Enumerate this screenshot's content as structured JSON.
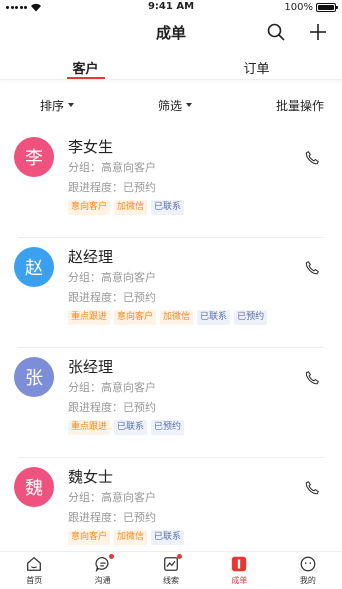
{
  "status": {
    "time": "9:41 AM",
    "battery": "100%",
    "battery_level": 1.0
  },
  "header": {
    "title": "成单"
  },
  "tabs": [
    {
      "label": "客户",
      "active": true
    },
    {
      "label": "订单",
      "active": false
    }
  ],
  "filters": {
    "sort": "排序",
    "filter": "筛选",
    "batch": "批量操作"
  },
  "customers": [
    {
      "avatar": "李",
      "name": "李女生",
      "group": "分组：高意向客户",
      "progress": "跟进程度：已预约",
      "color": "#f0527f",
      "tags": [
        {
          "text": "意向客户",
          "tone": "orange"
        },
        {
          "text": "加微信",
          "tone": "orange"
        },
        {
          "text": "已联系",
          "tone": "blue"
        }
      ]
    },
    {
      "avatar": "赵",
      "name": "赵经理",
      "group": "分组：高意向客户",
      "progress": "跟进程度：已预约",
      "color": "#3aa0f0",
      "tags": [
        {
          "text": "重点跟进",
          "tone": "orange"
        },
        {
          "text": "意向客户",
          "tone": "orange"
        },
        {
          "text": "加微信",
          "tone": "orange"
        },
        {
          "text": "已联系",
          "tone": "blue"
        },
        {
          "text": "已预约",
          "tone": "blue"
        }
      ]
    },
    {
      "avatar": "张",
      "name": "张经理",
      "group": "分组：高意向客户",
      "progress": "跟进程度：已预约",
      "color": "#7d8ed8",
      "tags": [
        {
          "text": "重点跟进",
          "tone": "orange"
        },
        {
          "text": "已联系",
          "tone": "blue"
        },
        {
          "text": "已预约",
          "tone": "blue"
        }
      ]
    },
    {
      "avatar": "魏",
      "name": "魏女士",
      "group": "分组：高意向客户",
      "progress": "跟进程度：已预约",
      "color": "#f0527f",
      "tags": [
        {
          "text": "意向客户",
          "tone": "orange"
        },
        {
          "text": "加微信",
          "tone": "orange"
        },
        {
          "text": "已联系",
          "tone": "blue"
        }
      ]
    }
  ],
  "bottom_nav": [
    {
      "label": "首页",
      "icon": "home-icon",
      "badge": false,
      "active": false
    },
    {
      "label": "沟通",
      "icon": "chat-icon",
      "badge": true,
      "active": false
    },
    {
      "label": "线索",
      "icon": "leads-icon",
      "badge": true,
      "active": false
    },
    {
      "label": "成单",
      "icon": "deal-icon",
      "badge": false,
      "active": true
    },
    {
      "label": "我的",
      "icon": "profile-icon",
      "badge": false,
      "active": false
    }
  ],
  "colors": {
    "accent": "#e53935",
    "tag_orange": "#f08a1c",
    "tag_blue": "#5b73a8"
  }
}
